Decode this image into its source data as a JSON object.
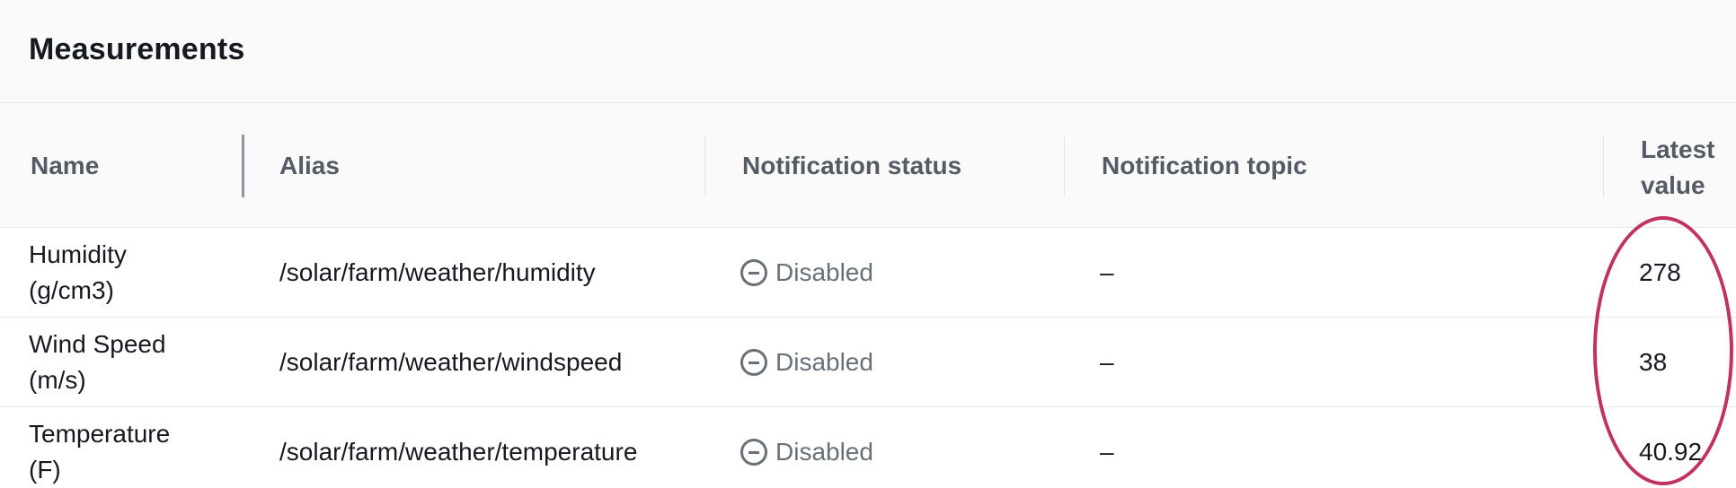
{
  "panel": {
    "title": "Measurements"
  },
  "table": {
    "headers": {
      "name": "Name",
      "alias": "Alias",
      "notification_status": "Notification status",
      "notification_topic": "Notification topic",
      "latest_value_line1": "Latest",
      "latest_value_line2": "value"
    },
    "rows": [
      {
        "name_line1": "Humidity",
        "name_line2": "(g/cm3)",
        "alias": "/solar/farm/weather/humidity",
        "status": "Disabled",
        "topic": "–",
        "latest": "278"
      },
      {
        "name_line1": "Wind Speed",
        "name_line2": "(m/s)",
        "alias": "/solar/farm/weather/windspeed",
        "status": "Disabled",
        "topic": "–",
        "latest": "38"
      },
      {
        "name_line1": "Temperature",
        "name_line2": "(F)",
        "alias": "/solar/farm/weather/temperature",
        "status": "Disabled",
        "topic": "–",
        "latest": "40.92"
      }
    ]
  },
  "icons": {
    "status": "disabled-minus-circle-icon"
  },
  "colors": {
    "highlight": "#c0335e",
    "status_gray": "#687078",
    "header_bg": "#fafafa"
  }
}
